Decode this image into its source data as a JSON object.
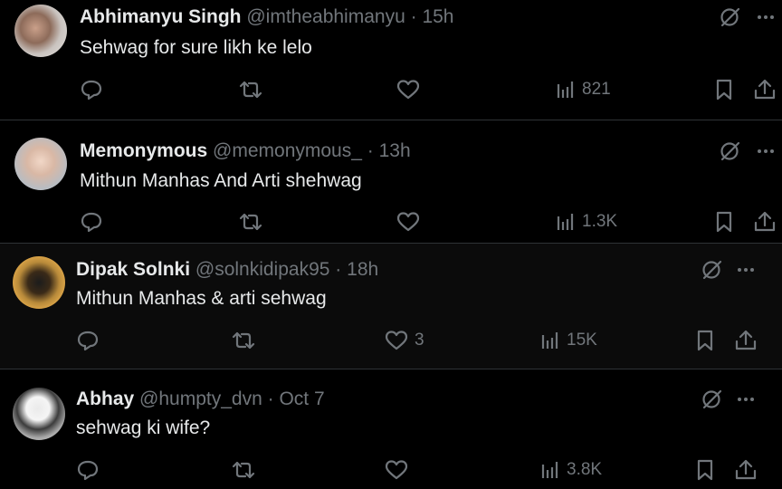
{
  "tweets": [
    {
      "name": "Abhimanyu Singh",
      "handle": "@imtheabhimanyu",
      "dot": "·",
      "time": "15h",
      "text": "Sehwag for sure likh ke lelo",
      "replies": "",
      "retweets": "",
      "likes": "",
      "views": "821"
    },
    {
      "name": "Memonymous",
      "handle": "@memonymous_",
      "dot": "·",
      "time": "13h",
      "text": "Mithun Manhas And Arti shehwag",
      "replies": "",
      "retweets": "",
      "likes": "",
      "views": "1.3K"
    },
    {
      "name": "Dipak Solnki",
      "handle": "@solnkidipak95",
      "dot": "·",
      "time": "18h",
      "text": "Mithun Manhas & arti sehwag",
      "replies": "",
      "retweets": "",
      "likes": "3",
      "views": "15K"
    },
    {
      "name": "Abhay",
      "handle": "@humpty_dvn",
      "dot": "·",
      "time": "Oct 7",
      "text": "sehwag ki wife?",
      "replies": "",
      "retweets": "",
      "likes": "",
      "views": "3.8K"
    }
  ],
  "icons": {
    "reply": "reply-icon",
    "retweet": "retweet-icon",
    "like": "heart-icon",
    "views": "views-icon",
    "bookmark": "bookmark-icon",
    "share": "share-icon",
    "grok": "grok-icon",
    "more": "more-icon"
  },
  "colors": {
    "background": "#000000",
    "text": "#e7e9ea",
    "secondary": "#71767b",
    "divider": "#2f3336"
  }
}
